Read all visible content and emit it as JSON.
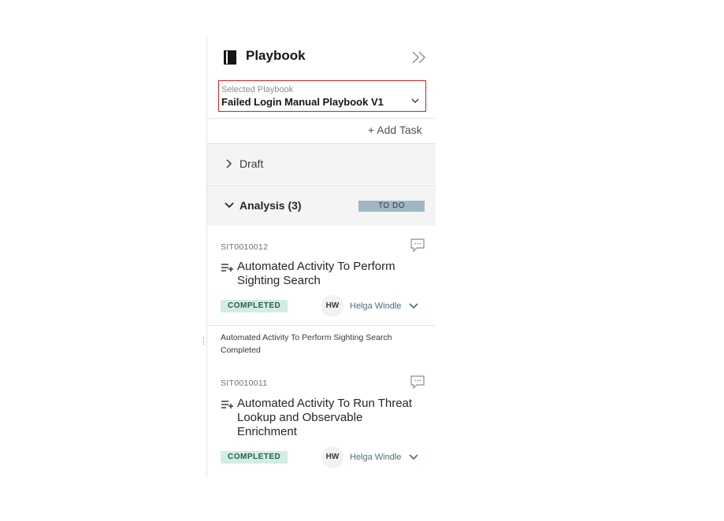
{
  "panel": {
    "title": "Playbook",
    "title_icon": "book-icon",
    "collapse_icon": "double-chevron-right-icon"
  },
  "selector": {
    "label": "Selected Playbook",
    "value": "Failed Login Manual Playbook V1",
    "highlight_color": "#da1e28"
  },
  "add_task_label": "+ Add Task",
  "sections": {
    "draft": {
      "label": "Draft",
      "expanded": false
    },
    "analysis": {
      "label": "Analysis (3)",
      "expanded": true,
      "status": "TO DO"
    }
  },
  "tasks": [
    {
      "id": "SIT0010012",
      "title": "Automated Activity To Perform Sighting Search",
      "status": "COMPLETED",
      "assignee_initials": "HW",
      "assignee_name": "Helga Windle"
    },
    {
      "id": "SIT0010011",
      "title": "Automated Activity To Run Threat Lookup and Observable Enrichment",
      "status": "COMPLETED",
      "assignee_initials": "HW",
      "assignee_name": "Helga Windle"
    }
  ],
  "activity_note": {
    "line1": "Automated Activity To Perform Sighting Search",
    "line2": "Completed"
  },
  "colors": {
    "completed_bg": "#d4ece2",
    "todo_bg": "#9eb7c3",
    "assignee_text": "#4a6f79"
  }
}
